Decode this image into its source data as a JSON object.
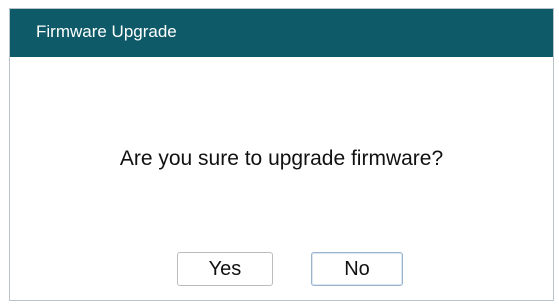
{
  "dialog": {
    "title": "Firmware Upgrade",
    "message": "Are you sure to upgrade firmware?",
    "buttons": {
      "yes_label": "Yes",
      "no_label": "No"
    }
  },
  "colors": {
    "titlebar": "#0e5a68",
    "title_text": "#ffffff",
    "body_background": "#ffffff",
    "focused_button_border": "#9ab3cc"
  }
}
